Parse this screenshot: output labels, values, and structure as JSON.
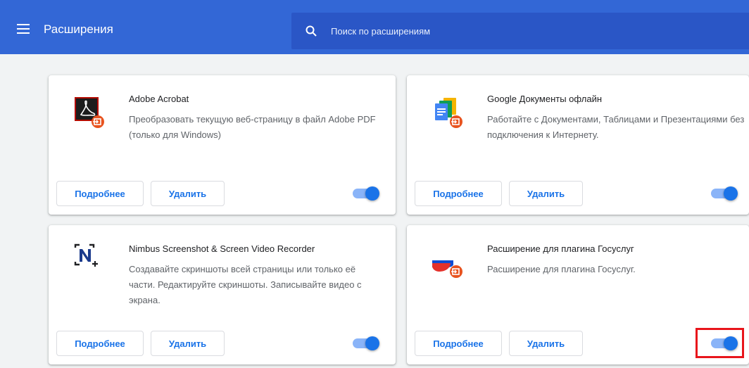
{
  "header": {
    "title": "Расширения",
    "search_placeholder": "Поиск по расширениям",
    "search_value": ""
  },
  "colors": {
    "toolbar": "#3367d6",
    "accent": "#1a73e8",
    "highlight": "#e8151b"
  },
  "extensions": [
    {
      "name": "Adobe Acrobat",
      "description": "Преобразовать текущую веб-страницу в файл Adobe PDF (только для Windows)",
      "details_label": "Подробнее",
      "remove_label": "Удалить",
      "enabled": true,
      "icon": "adobe-acrobat-icon"
    },
    {
      "name": "Google Документы офлайн",
      "description": "Работайте с Документами, Таблицами и Презентациями без подключения к Интернету.",
      "details_label": "Подробнее",
      "remove_label": "Удалить",
      "enabled": true,
      "icon": "google-docs-offline-icon"
    },
    {
      "name": "Nimbus Screenshot & Screen Video Recorder",
      "description": "Создавайте скриншоты всей страницы или только её части. Редактируйте скриншоты. Записывайте видео с экрана.",
      "details_label": "Подробнее",
      "remove_label": "Удалить",
      "enabled": true,
      "icon": "nimbus-icon"
    },
    {
      "name": "Расширение для плагина Госуслуг",
      "description": "Расширение для плагина Госуслуг.",
      "details_label": "Подробнее",
      "remove_label": "Удалить",
      "enabled": true,
      "icon": "gosuslugi-icon",
      "toggle_highlighted": true
    }
  ]
}
